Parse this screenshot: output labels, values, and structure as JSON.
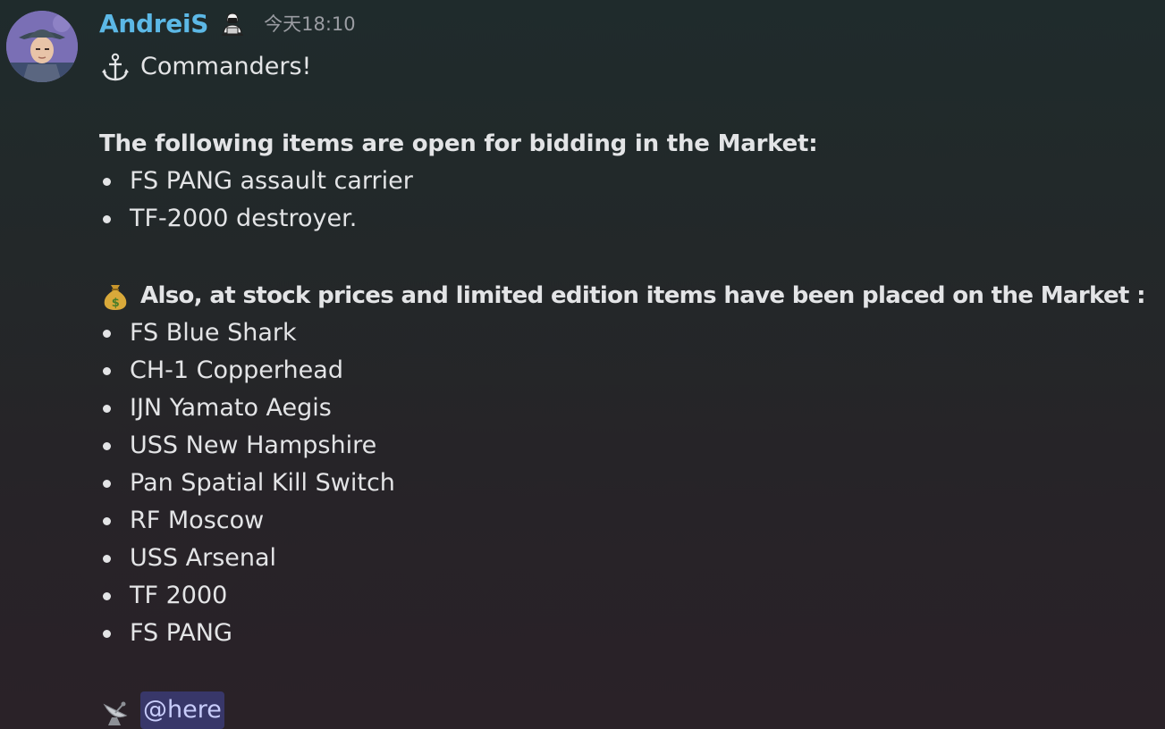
{
  "message": {
    "author": "AndreiS",
    "role_icon": "hacker-silhouette-icon",
    "timestamp": "今天18:10",
    "greeting_icon": "anchor-icon",
    "greeting": "Commanders!",
    "bidding_heading": "The following items are open for bidding in the Market:",
    "bidding_items": [
      "FS PANG assault carrier",
      "TF-2000 destroyer."
    ],
    "stock_icon": "money-bag-icon",
    "stock_heading": "Also, at stock prices and limited edition items have been placed on the Market :",
    "stock_items": [
      "FS Blue Shark",
      "CH-1 Copperhead",
      "IJN Yamato Aegis",
      "USS New Hampshire",
      "Pan Spatial Kill Switch",
      "RF Moscow",
      "USS Arsenal",
      "TF 2000",
      "FS PANG"
    ],
    "footer_icon": "satellite-dish-icon",
    "mention": "@here"
  },
  "colors": {
    "username": "#5cb8e6",
    "text": "#e3e4e6",
    "timestamp": "#9a9ca2",
    "mention_bg": "#3d4280",
    "mention_text": "#c9cdfb"
  }
}
